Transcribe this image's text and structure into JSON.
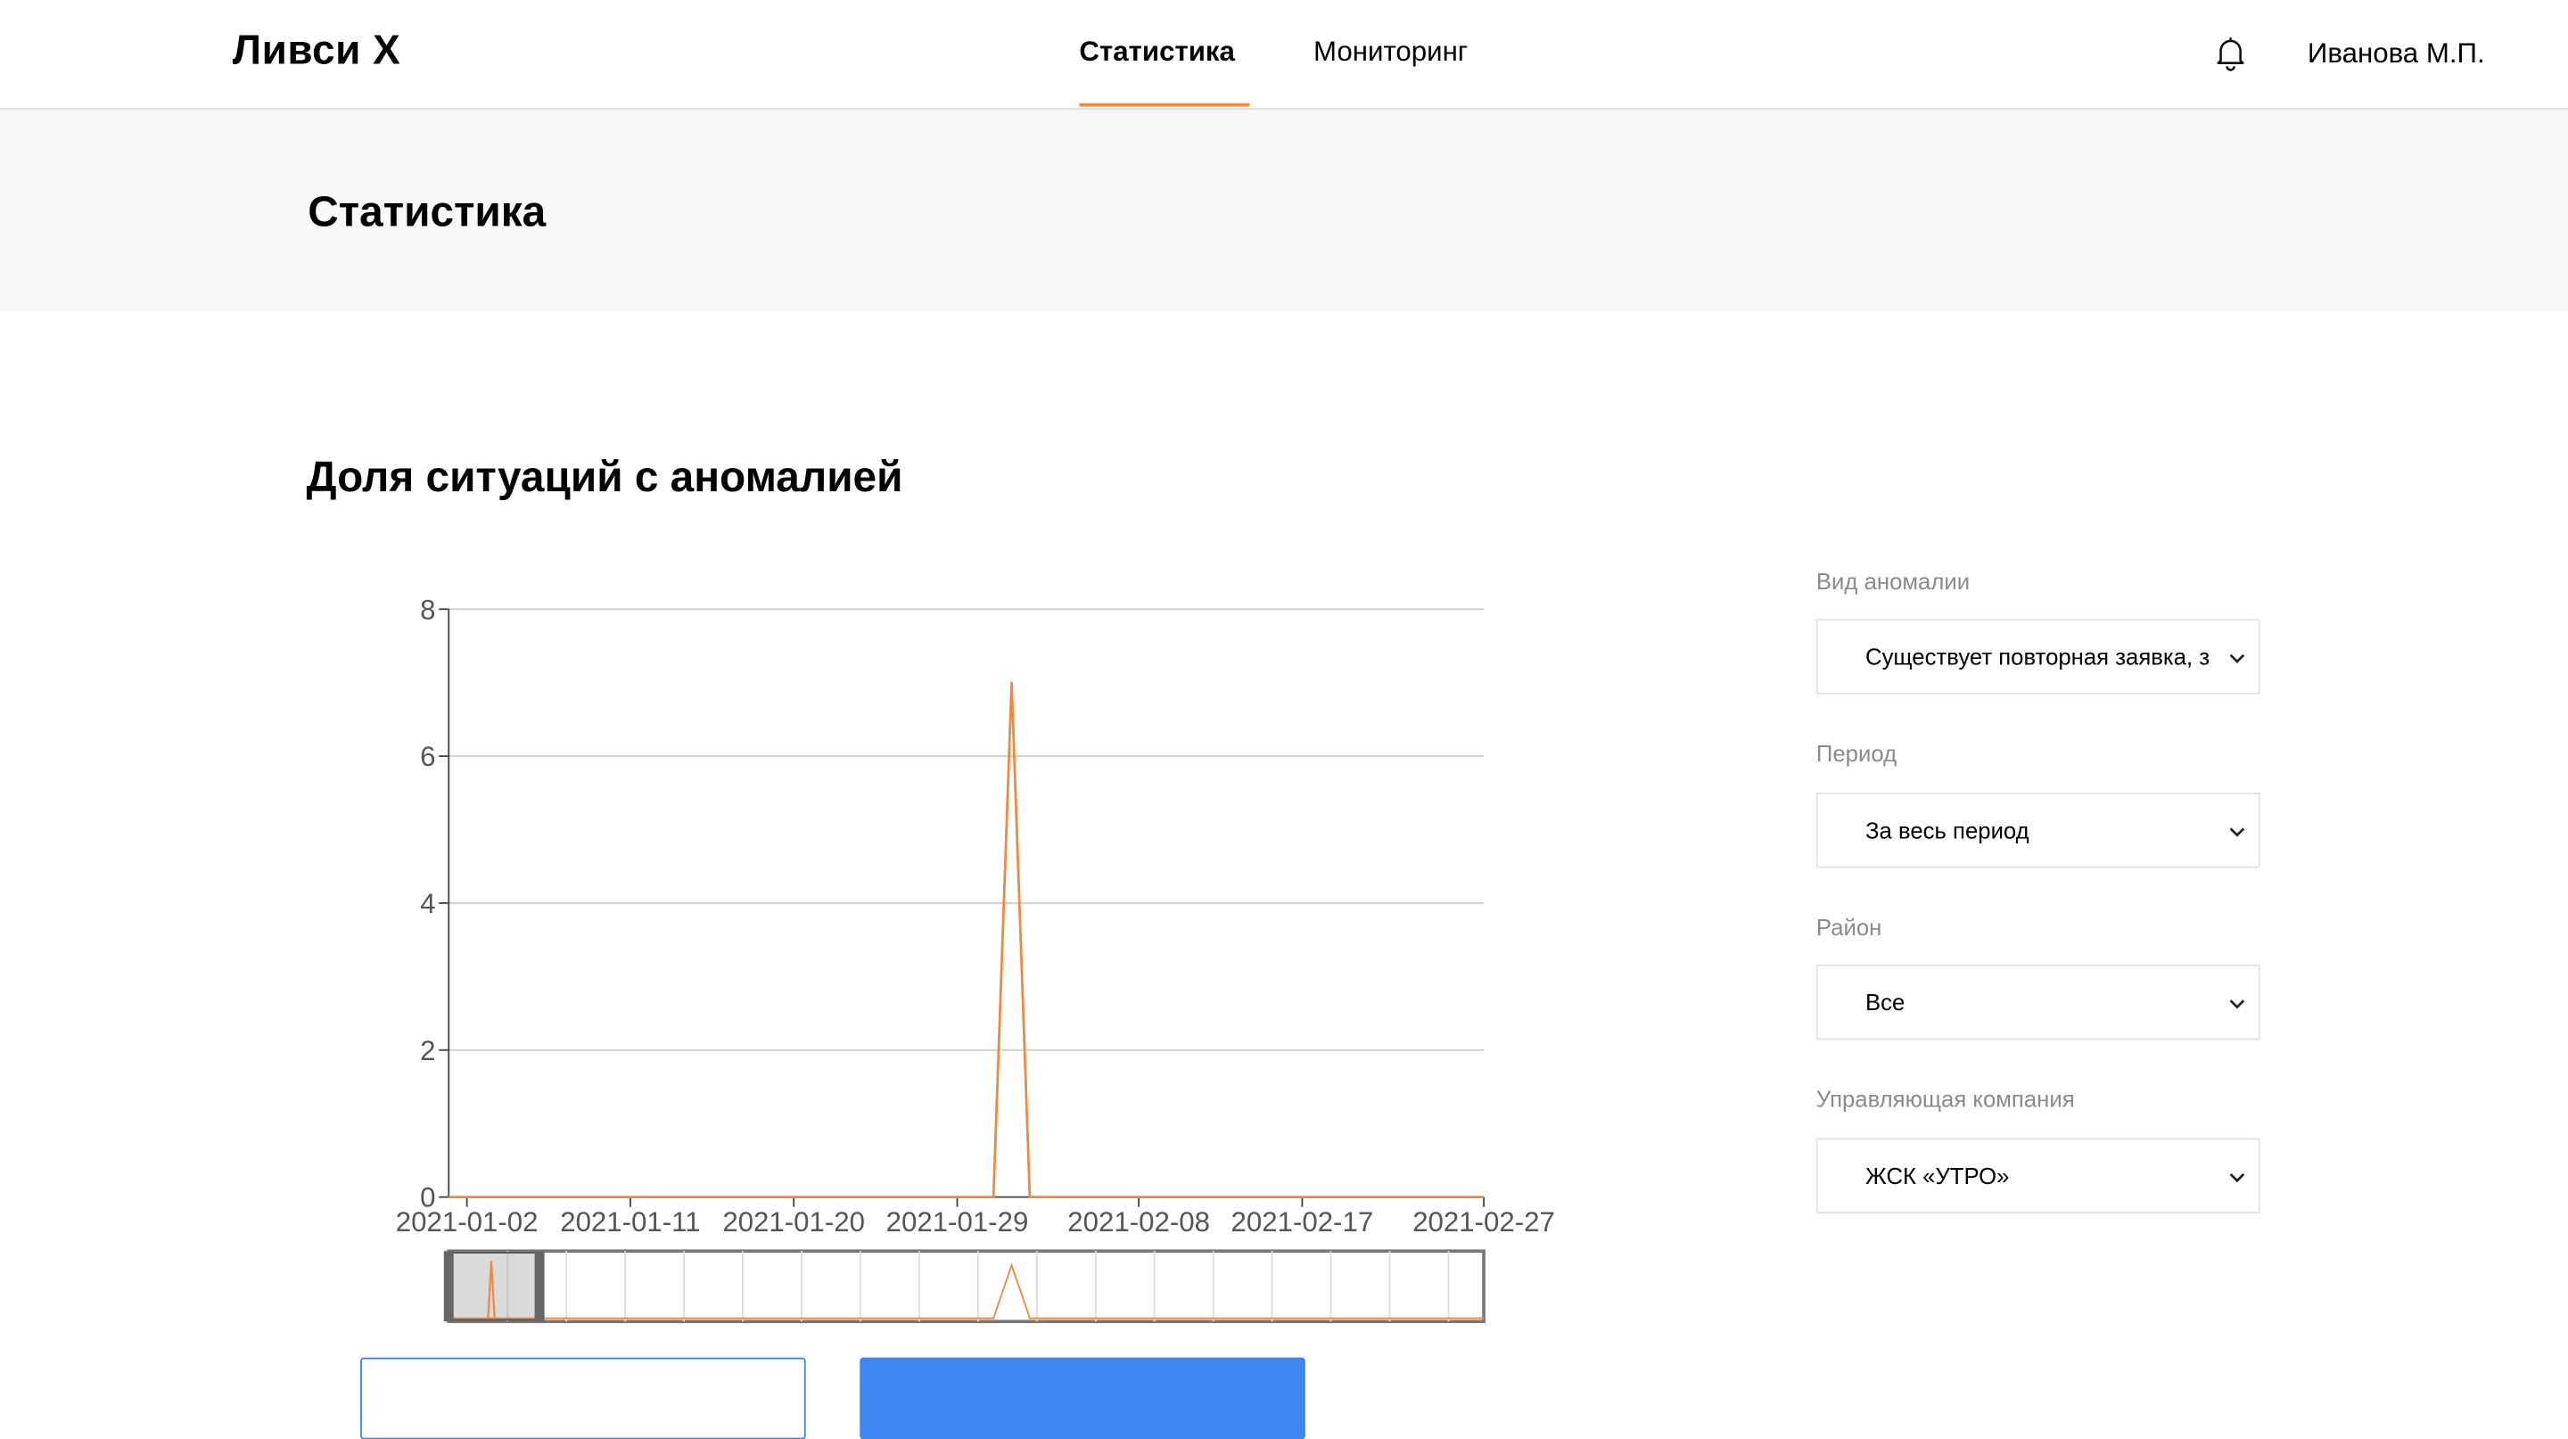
{
  "app": {
    "title": "Ливси X"
  },
  "nav": {
    "items": [
      "Статистика",
      "Мониторинг"
    ],
    "active": "Статистика"
  },
  "user": {
    "name": "Иванова М.П."
  },
  "page": {
    "title": "Статистика"
  },
  "section": {
    "title": "Доля ситуаций с аномалией"
  },
  "filters": [
    {
      "label": "Вид аномалии",
      "value": "Существует повторная заявка, з"
    },
    {
      "label": "Период",
      "value": "За весь период"
    },
    {
      "label": "Район",
      "value": "Все"
    },
    {
      "label": "Управляющая компания",
      "value": "ЖСК «УТРО»"
    }
  ],
  "colors": {
    "accent": "#f0883e",
    "primary": "#3e87f3",
    "line": "#f0883e",
    "grid": "#d0d0d0"
  },
  "icons": {
    "notifications": "bell-icon",
    "dropdown": "chevron-down-icon"
  },
  "chart_data": {
    "type": "line",
    "x_dates": [
      "2021-01-02",
      "2021-01-11",
      "2021-01-20",
      "2021-01-29",
      "2021-02-08",
      "2021-02-17",
      "2021-02-27"
    ],
    "xlim": [
      "2021-01-01",
      "2021-02-27"
    ],
    "ylim": [
      0,
      8
    ],
    "yticks": [
      0,
      2,
      4,
      6,
      8
    ],
    "grid": true,
    "series": [
      {
        "points": [
          {
            "x": "2021-01-01",
            "y": 0
          },
          {
            "x": "2021-01-31",
            "y": 0
          },
          {
            "x": "2021-02-01",
            "y": 7
          },
          {
            "x": "2021-02-02",
            "y": 0
          },
          {
            "x": "2021-02-27",
            "y": 0
          }
        ]
      }
    ],
    "navigator": {
      "selection_start": "2021-01-01",
      "selection_end": "2021-01-06"
    }
  }
}
